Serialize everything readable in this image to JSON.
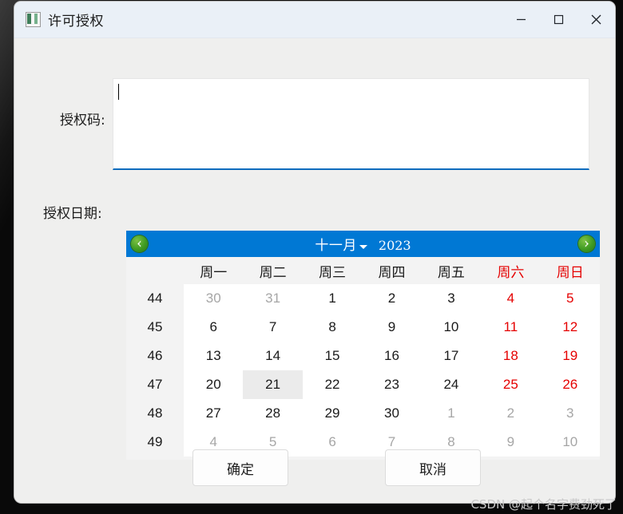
{
  "window": {
    "title": "许可授权",
    "icon": "app-window-icon",
    "controls": {
      "minimize": "minimize-icon",
      "maximize": "maximize-icon",
      "close": "close-icon"
    }
  },
  "form": {
    "code_label": "授权码:",
    "code_value": "",
    "date_label": "授权日期:"
  },
  "calendar": {
    "prev_icon": "arrow-left-icon",
    "next_icon": "arrow-right-icon",
    "month": "十一月",
    "year": "2023",
    "weekdays": [
      "周一",
      "周二",
      "周三",
      "周四",
      "周五",
      "周六",
      "周日"
    ],
    "weekend_indices": [
      5,
      6
    ],
    "week_numbers": [
      "44",
      "45",
      "46",
      "47",
      "48",
      "49"
    ],
    "selected_day": "21",
    "rows": [
      [
        {
          "d": "30",
          "other": true,
          "weekend": false
        },
        {
          "d": "31",
          "other": true,
          "weekend": false
        },
        {
          "d": "1",
          "other": false,
          "weekend": false
        },
        {
          "d": "2",
          "other": false,
          "weekend": false
        },
        {
          "d": "3",
          "other": false,
          "weekend": false
        },
        {
          "d": "4",
          "other": false,
          "weekend": true
        },
        {
          "d": "5",
          "other": false,
          "weekend": true
        }
      ],
      [
        {
          "d": "6",
          "other": false,
          "weekend": false
        },
        {
          "d": "7",
          "other": false,
          "weekend": false
        },
        {
          "d": "8",
          "other": false,
          "weekend": false
        },
        {
          "d": "9",
          "other": false,
          "weekend": false
        },
        {
          "d": "10",
          "other": false,
          "weekend": false
        },
        {
          "d": "11",
          "other": false,
          "weekend": true
        },
        {
          "d": "12",
          "other": false,
          "weekend": true
        }
      ],
      [
        {
          "d": "13",
          "other": false,
          "weekend": false
        },
        {
          "d": "14",
          "other": false,
          "weekend": false
        },
        {
          "d": "15",
          "other": false,
          "weekend": false
        },
        {
          "d": "16",
          "other": false,
          "weekend": false
        },
        {
          "d": "17",
          "other": false,
          "weekend": false
        },
        {
          "d": "18",
          "other": false,
          "weekend": true
        },
        {
          "d": "19",
          "other": false,
          "weekend": true
        }
      ],
      [
        {
          "d": "20",
          "other": false,
          "weekend": false
        },
        {
          "d": "21",
          "other": false,
          "weekend": false,
          "selected": true
        },
        {
          "d": "22",
          "other": false,
          "weekend": false
        },
        {
          "d": "23",
          "other": false,
          "weekend": false
        },
        {
          "d": "24",
          "other": false,
          "weekend": false
        },
        {
          "d": "25",
          "other": false,
          "weekend": true
        },
        {
          "d": "26",
          "other": false,
          "weekend": true
        }
      ],
      [
        {
          "d": "27",
          "other": false,
          "weekend": false
        },
        {
          "d": "28",
          "other": false,
          "weekend": false
        },
        {
          "d": "29",
          "other": false,
          "weekend": false
        },
        {
          "d": "30",
          "other": false,
          "weekend": false
        },
        {
          "d": "1",
          "other": true,
          "weekend": false
        },
        {
          "d": "2",
          "other": true,
          "weekend": true
        },
        {
          "d": "3",
          "other": true,
          "weekend": true
        }
      ],
      [
        {
          "d": "4",
          "other": true,
          "weekend": false
        },
        {
          "d": "5",
          "other": true,
          "weekend": false
        },
        {
          "d": "6",
          "other": true,
          "weekend": false
        },
        {
          "d": "7",
          "other": true,
          "weekend": false
        },
        {
          "d": "8",
          "other": true,
          "weekend": false
        },
        {
          "d": "9",
          "other": true,
          "weekend": true
        },
        {
          "d": "10",
          "other": true,
          "weekend": true
        }
      ]
    ]
  },
  "footer": {
    "ok_label": "确定",
    "cancel_label": "取消"
  },
  "watermark": "CSDN @起个名字费劲死了",
  "colors": {
    "calendar_header": "#0078d4",
    "weekend_text": "#e50000",
    "focus_underline": "#0f6cbd",
    "nav_button": "#3f9b22"
  }
}
